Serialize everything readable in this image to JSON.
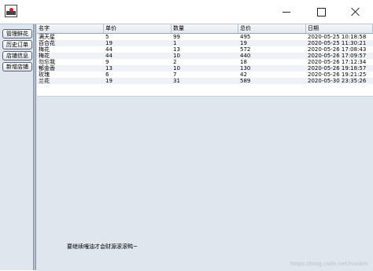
{
  "window": {
    "icon": "app-window-icon"
  },
  "window_controls": {
    "minimize": "minimize-icon",
    "maximize": "maximize-icon",
    "close": "close-icon"
  },
  "sidebar": {
    "items": [
      {
        "label": "管理鲜花"
      },
      {
        "label": "历史订单"
      },
      {
        "label": "店铺信息"
      },
      {
        "label": "新增店铺"
      }
    ]
  },
  "table": {
    "columns": [
      "名字",
      "单价",
      "数量",
      "总价",
      "日期"
    ],
    "rows": [
      [
        "满天星",
        "5",
        "99",
        "495",
        "2020-05-25 10:18:58"
      ],
      [
        "百合花",
        "19",
        "1",
        "19",
        "2020-05-25 11:30:21"
      ],
      [
        "梅花",
        "44",
        "13",
        "572",
        "2020-05-26 17:08:43"
      ],
      [
        "梅花",
        "44",
        "10",
        "440",
        "2020-05-26 17:09:57"
      ],
      [
        "勿忘我",
        "9",
        "2",
        "18",
        "2020-05-26 17:12:34"
      ],
      [
        "郁金香",
        "13",
        "10",
        "130",
        "2020-05-26 19:18:57"
      ],
      [
        "玫瑰",
        "6",
        "7",
        "42",
        "2020-05-26 19:21:25"
      ],
      [
        "兰花",
        "19",
        "31",
        "589",
        "2020-05-30 23:35:26"
      ]
    ]
  },
  "footer": {
    "motto": "要继续嘎油才会财源滚滚鸭~",
    "watermark": "https://blog.csdn.net/ruvikm"
  }
}
